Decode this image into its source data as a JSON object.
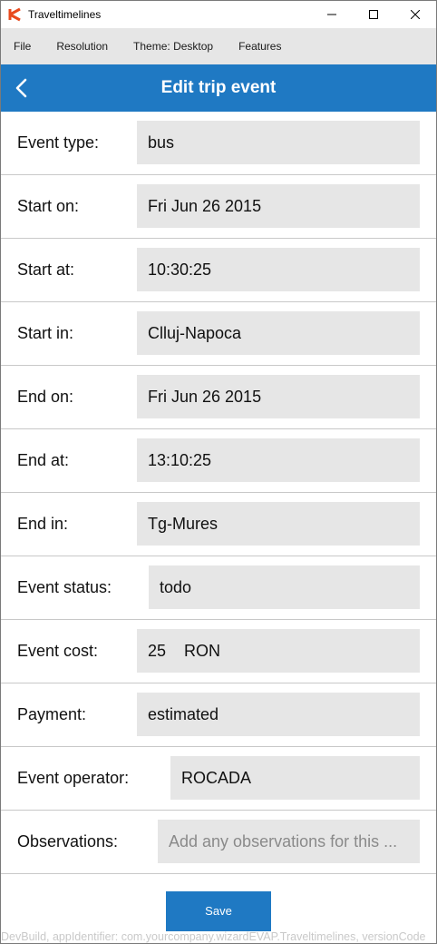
{
  "window": {
    "title": "Traveltimelines",
    "controls": {
      "minimize": "—",
      "maximize": "☐",
      "close": "✕"
    }
  },
  "menu": {
    "items": [
      "File",
      "Resolution",
      "Theme: Desktop",
      "Features"
    ]
  },
  "header": {
    "title": "Edit trip event",
    "back_icon": "chevron-left-icon"
  },
  "fields": [
    {
      "label": "Event type:",
      "value": "bus",
      "placeholder": ""
    },
    {
      "label": "Start on:",
      "value": "Fri Jun 26 2015",
      "placeholder": ""
    },
    {
      "label": "Start at:",
      "value": "10:30:25",
      "placeholder": ""
    },
    {
      "label": "Start in:",
      "value": "Clluj-Napoca",
      "placeholder": ""
    },
    {
      "label": "End on:",
      "value": "Fri Jun 26 2015",
      "placeholder": ""
    },
    {
      "label": "End at:",
      "value": "13:10:25",
      "placeholder": ""
    },
    {
      "label": "End in:",
      "value": "Tg-Mures",
      "placeholder": ""
    },
    {
      "label": "Event status:",
      "value": "todo",
      "placeholder": ""
    },
    {
      "label": "Event cost:",
      "value": "25    RON",
      "placeholder": ""
    },
    {
      "label": "Payment:",
      "value": "estimated",
      "placeholder": ""
    },
    {
      "label": "Event operator:",
      "value": "ROCADA",
      "placeholder": ""
    },
    {
      "label": "Observations:",
      "value": "",
      "placeholder": "Add any observations for this ..."
    }
  ],
  "save_label": "Save",
  "footer_text": "DevBuild, appIdentifier: com.yourcompany.wizardEVAP.Traveltimelines, versionCode",
  "colors": {
    "accent": "#1f79c3",
    "field_bg": "#e6e6e6",
    "menubar_bg": "#e6e6e6"
  }
}
